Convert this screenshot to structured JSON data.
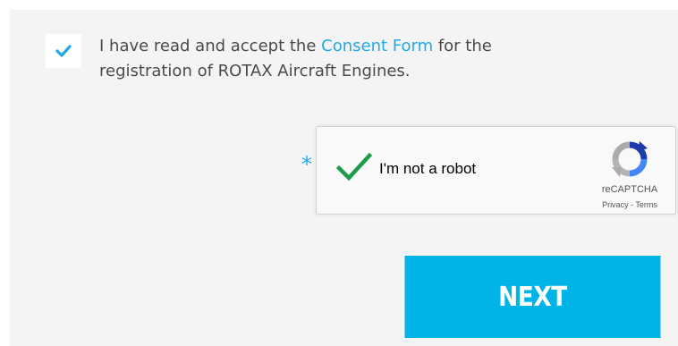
{
  "consent": {
    "checked": true,
    "text_before": "I have read and accept the ",
    "link_text": "Consent Form",
    "text_after": " for the registration of ROTAX Aircraft Engines."
  },
  "captcha": {
    "required_mark": "*",
    "label": "I'm not a robot",
    "checked": true,
    "brand": "reCAPTCHA",
    "privacy_link": "Privacy",
    "separator": " - ",
    "terms_link": "Terms"
  },
  "actions": {
    "next_label": "NEXT"
  },
  "colors": {
    "accent": "#22a8e6",
    "button": "#00b4e8",
    "panel": "#f4f4f4",
    "captcha_check": "#1d9b4b"
  }
}
